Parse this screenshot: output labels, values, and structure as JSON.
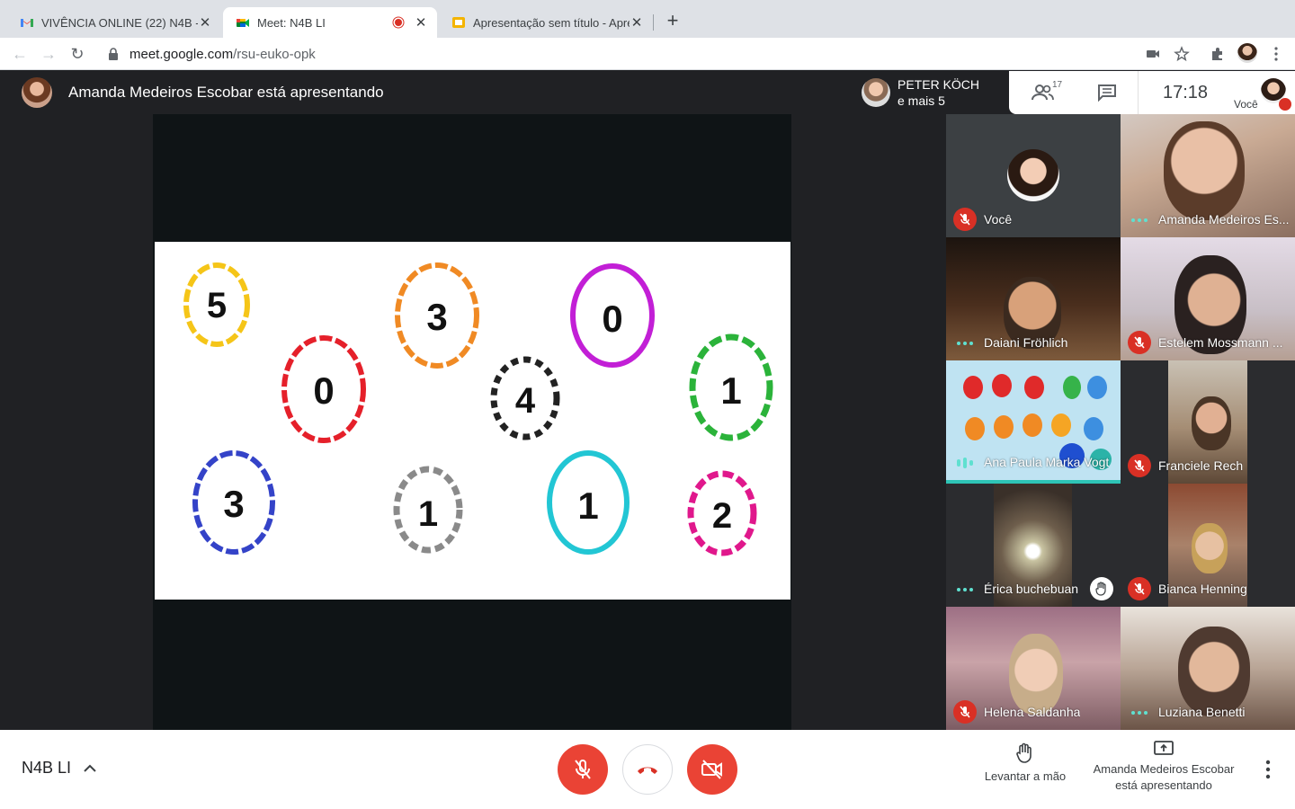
{
  "browser": {
    "tabs": [
      {
        "title": "VIVÊNCIA ONLINE (22) N4B - f",
        "icon": "gmail-icon"
      },
      {
        "title": "Meet: N4B LI",
        "icon": "meet-icon",
        "recording": true
      },
      {
        "title": "Apresentação sem título - Apre",
        "icon": "slides-icon"
      }
    ],
    "url_host": "meet.google.com",
    "url_path": "/rsu-euko-opk"
  },
  "meet": {
    "presenter_banner": "Amanda Medeiros Escobar está apresentando",
    "viewer_chip": {
      "name": "PETER KÖCH",
      "more": "e mais 5"
    },
    "participants_count": "17",
    "clock": "17:18",
    "self_label": "Você",
    "slide": {
      "eggs": [
        {
          "number": "5",
          "color": "#f5c518"
        },
        {
          "number": "3",
          "color": "#f08a24"
        },
        {
          "number": "0",
          "color": "#c21fd6"
        },
        {
          "number": "0",
          "color": "#e5202a"
        },
        {
          "number": "4",
          "color": "#222222"
        },
        {
          "number": "1",
          "color": "#2bb33a"
        },
        {
          "number": "3",
          "color": "#3443c8"
        },
        {
          "number": "1",
          "color": "#8a8a8a"
        },
        {
          "number": "1",
          "color": "#22c6d4"
        },
        {
          "number": "2",
          "color": "#e0188c"
        }
      ]
    },
    "tiles": [
      {
        "name": "Você",
        "status": "muted"
      },
      {
        "name": "Amanda Medeiros Es...",
        "status": "speaking-dots"
      },
      {
        "name": "Daiani Fröhlich",
        "status": "speaking-dots"
      },
      {
        "name": "Estelem Mossmann ...",
        "status": "muted"
      },
      {
        "name": "Ana Paula Marka Vogt",
        "status": "speaking"
      },
      {
        "name": "Franciele Rech",
        "status": "muted"
      },
      {
        "name": "Érica buchebuan",
        "status": "speaking-dots",
        "hand_raised": true
      },
      {
        "name": "Bianca Henning",
        "status": "muted"
      },
      {
        "name": "Helena Saldanha",
        "status": "muted"
      },
      {
        "name": "Luziana Benetti",
        "status": "speaking-dots"
      }
    ],
    "bottom": {
      "meeting_name": "N4B LI",
      "raise_hand_label": "Levantar a mão",
      "presenting_line1": "Amanda Medeiros Escobar",
      "presenting_line2": "está apresentando"
    },
    "colors": {
      "red": "#ea4335",
      "teal": "#5fe0d0",
      "dark": "#202124"
    }
  }
}
